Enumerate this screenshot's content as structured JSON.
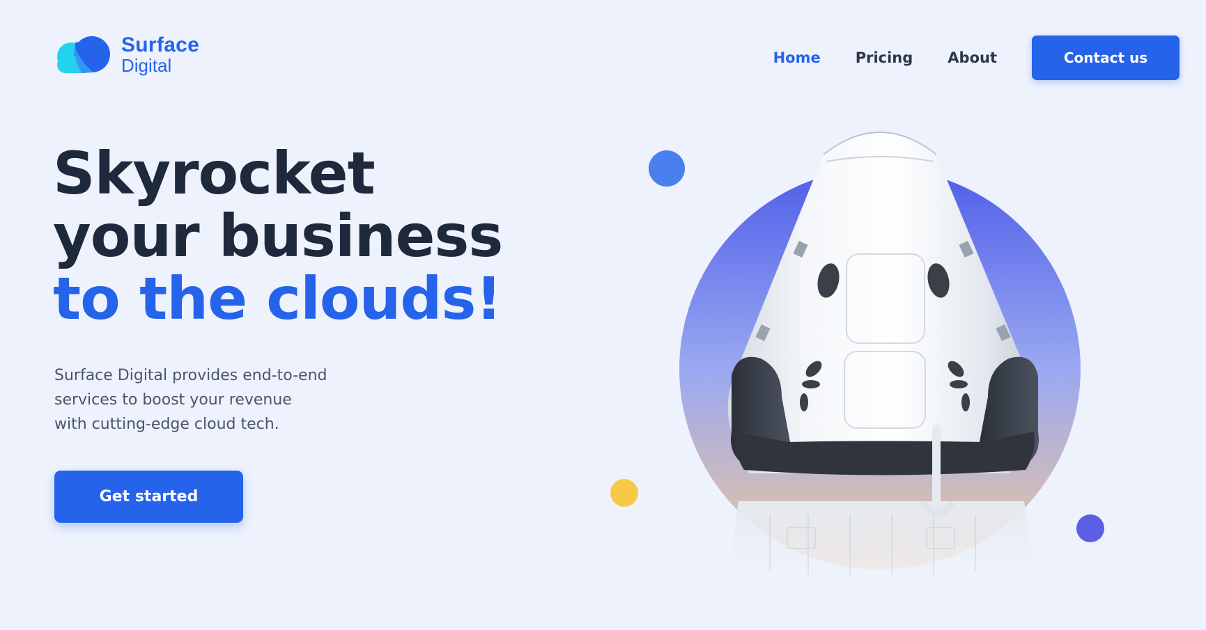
{
  "brand": {
    "name_top": "Surface",
    "name_bottom": "Digital",
    "icon": "cloud-logo-icon"
  },
  "nav": {
    "links": [
      {
        "label": "Home",
        "active": true
      },
      {
        "label": "Pricing",
        "active": false
      },
      {
        "label": "About",
        "active": false
      }
    ],
    "contact_label": "Contact us"
  },
  "hero": {
    "title_line1": "Skyrocket",
    "title_line2": "your business",
    "title_line3": "to the clouds!",
    "description_line1": "Surface Digital provides end-to-end",
    "description_line2": "services to boost your revenue",
    "description_line3": "with cutting-edge cloud tech.",
    "cta_label": "Get started"
  },
  "illustration": {
    "icon": "rocket-capsule-icon"
  },
  "colors": {
    "background": "#eef2fc",
    "primary": "#2563eb",
    "heading": "#1e293b",
    "body_text": "#4a5568",
    "nav_text": "#2d3748",
    "dot_blue": "#4a7ff0",
    "dot_yellow": "#f7c948",
    "dot_purple": "#5b5fe6",
    "circle_top": "#4f5ee8",
    "circle_bottom": "#eec89a"
  }
}
